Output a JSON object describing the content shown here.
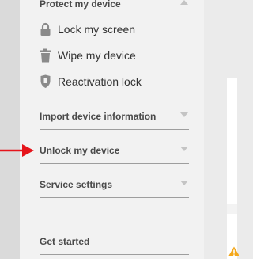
{
  "sidebar": {
    "protect": {
      "title": "Protect my device",
      "items": [
        {
          "label": "Lock my screen",
          "icon": "lock-icon"
        },
        {
          "label": "Wipe my device",
          "icon": "trash-icon"
        },
        {
          "label": "Reactivation lock",
          "icon": "shield-icon"
        }
      ]
    },
    "import": {
      "title": "Import device information"
    },
    "unlock": {
      "title": "Unlock my device"
    },
    "service": {
      "title": "Service settings"
    },
    "get_started": {
      "title": "Get started"
    }
  },
  "annotation": {
    "arrow_color": "#e5141b"
  },
  "right_panel": {
    "warning_icon": "warning-icon",
    "warning_color": "#f4a81c"
  }
}
